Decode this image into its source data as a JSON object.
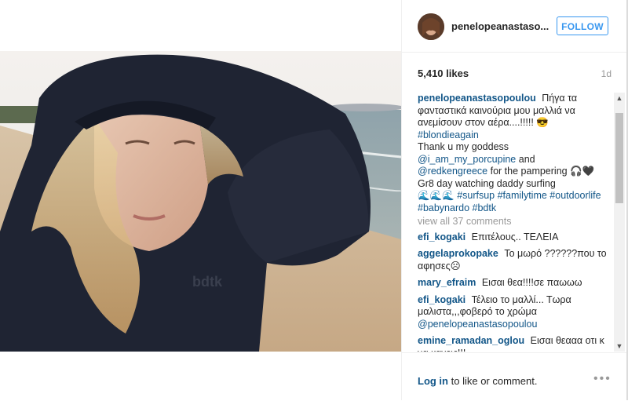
{
  "post": {
    "username": "penelopeanastaso...",
    "follow_label": "FOLLOW",
    "likes": "5,410 likes",
    "time": "1d",
    "caption": {
      "username": "penelopeanastasopoulou",
      "text1": "Πήγα τα φανταστικά καινούρια μου μαλλιά να ανεμίσουν στον αέρα....!!!!!",
      "hashtag1": "#blondieagain",
      "text2": "Thank u my goddess",
      "mention1": "@i_am_my_porcupine",
      "and": "and",
      "mention2": "@redkengreece",
      "text3": "for the pampering",
      "text4": "Gr8 day watching daddy surfing",
      "tags_line1": "#surfsup #familytime #outdoorlife",
      "tags_line2": "#babynardo #bdtk"
    },
    "view_all": "view all 37 comments",
    "comments": [
      {
        "user": "efi_kogaki",
        "text": "Επιτέλους.. ΤΕΛΕΙΑ"
      },
      {
        "user": "aggelaprokopake",
        "text": "Το μωρό ??????που το αφησες☹"
      },
      {
        "user": "mary_efraim",
        "text": "Εισαι θεα!!!!σε παωωω"
      },
      {
        "user": "efi_kogaki",
        "text": "Τέλειο το μαλλί... Τωρα μαλιστα,,,φοβερό το χρώμα",
        "mention": "@penelopeanastasopoulou"
      },
      {
        "user": "emine_ramadan_oglou",
        "text": "Εισαι θεααα οτι κ να κανεις!!!"
      }
    ],
    "login_link": "Log in",
    "login_text": "to like or comment.",
    "more": "•••"
  }
}
